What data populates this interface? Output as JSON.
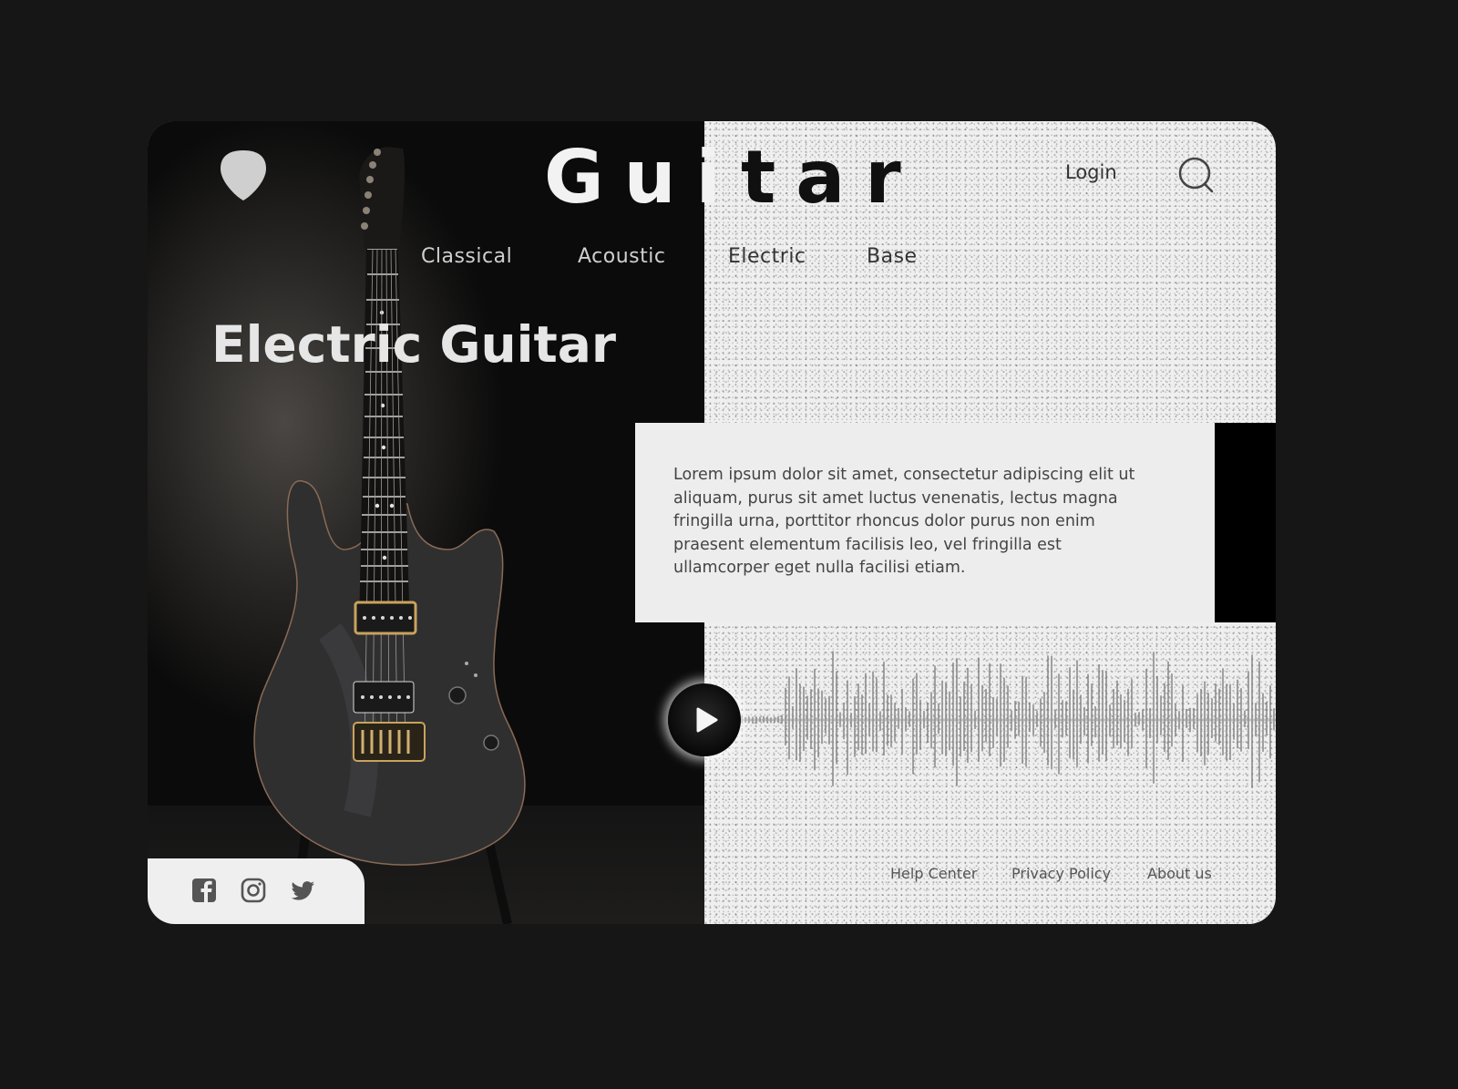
{
  "header": {
    "logo_icon": "guitar-pick-icon",
    "logo_part1": "Gui",
    "logo_part2": "tar",
    "login_label": "Login",
    "search_icon": "search-icon"
  },
  "nav": {
    "items": [
      {
        "label": "Classical"
      },
      {
        "label": "Acoustic"
      },
      {
        "label": "Electric"
      },
      {
        "label": "Base"
      }
    ]
  },
  "hero": {
    "title": "Electric Guitar",
    "image": "electric-guitar-photo"
  },
  "description": {
    "text": "Lorem ipsum dolor sit amet, consectetur adipiscing elit ut aliquam, purus sit amet luctus venenatis, lectus magna fringilla urna, porttitor rhoncus dolor purus non enim praesent elementum facilisis leo, vel fringilla est ullamcorper eget nulla facilisi etiam."
  },
  "player": {
    "play_icon": "play-icon",
    "waveform": "audio-waveform"
  },
  "footer": {
    "links": [
      {
        "label": "Help Center"
      },
      {
        "label": "Privacy Policy"
      },
      {
        "label": "About us"
      }
    ],
    "social": [
      "facebook-icon",
      "instagram-icon",
      "twitter-icon"
    ]
  },
  "colors": {
    "background": "#161616",
    "panel_light": "#efefef",
    "panel_dark": "#000000",
    "text_dark": "#333333",
    "text_light": "#e6e6e6"
  }
}
